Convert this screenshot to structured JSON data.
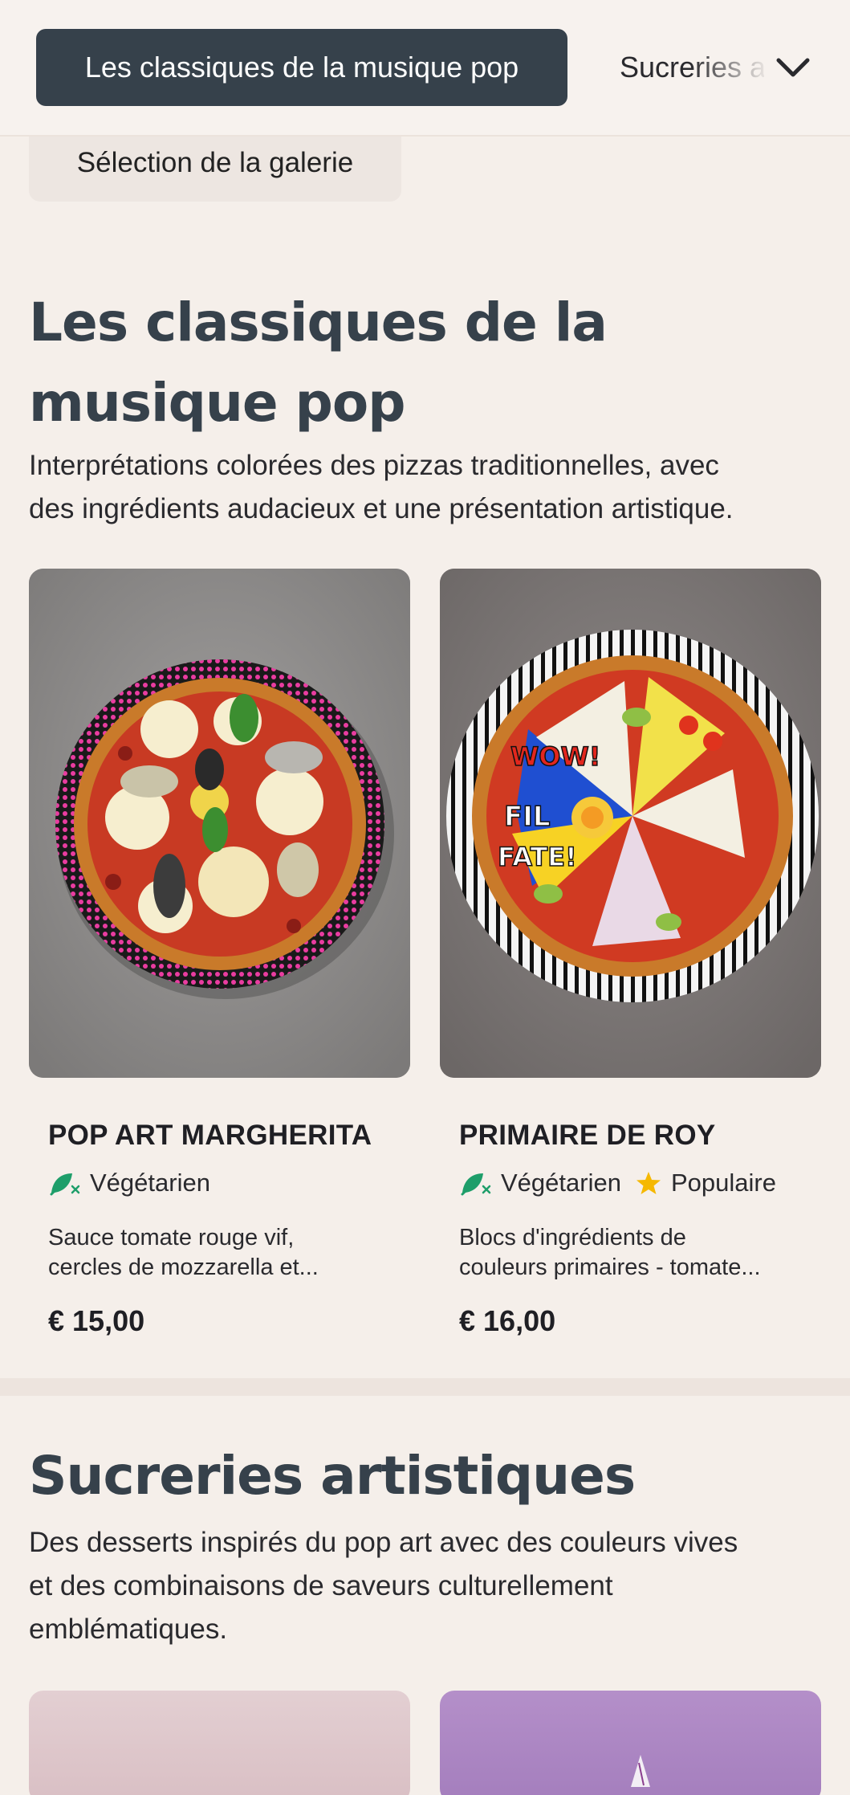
{
  "nav": {
    "active_label": "Les classiques de la musique pop",
    "next_label": "Sucreries artistiques",
    "chevron_icon": "chevron-down-icon",
    "gallery_label": "Sélection de la galerie"
  },
  "sections": [
    {
      "title_line1": "Les classiques de la",
      "title_line2": "musique pop",
      "desc_line1": "Interprétations colorées des pizzas traditionnelles, avec",
      "desc_line2": "des ingrédients audacieux et une présentation artistique.",
      "items": [
        {
          "name": "POP ART MARGHERITA",
          "tags": [
            {
              "icon": "vegetarian-leaf-icon",
              "label": "Végétarien"
            }
          ],
          "desc_line1": "Sauce tomate rouge vif,",
          "desc_line2": "cercles de mozzarella et...",
          "price": "€ 15,00"
        },
        {
          "name": "PRIMAIRE DE ROY",
          "tags": [
            {
              "icon": "vegetarian-leaf-icon",
              "label": "Végétarien"
            },
            {
              "icon": "star-icon",
              "label": "Populaire"
            }
          ],
          "desc_line1": "Blocs d'ingrédients de",
          "desc_line2": "couleurs primaires - tomate...",
          "price": "€ 16,00"
        }
      ]
    },
    {
      "title_line1": "Sucreries artistiques",
      "desc_line1": "Des desserts inspirés du pop art avec des couleurs vives",
      "desc_line2": "et des combinaisons de saveurs culturellement",
      "desc_line3": "emblématiques."
    }
  ],
  "colors": {
    "background": "#f5efea",
    "nav_active": "#36414b",
    "heading": "#36414b",
    "leaf_green": "#1e9e6a",
    "star_yellow": "#f5b800"
  }
}
